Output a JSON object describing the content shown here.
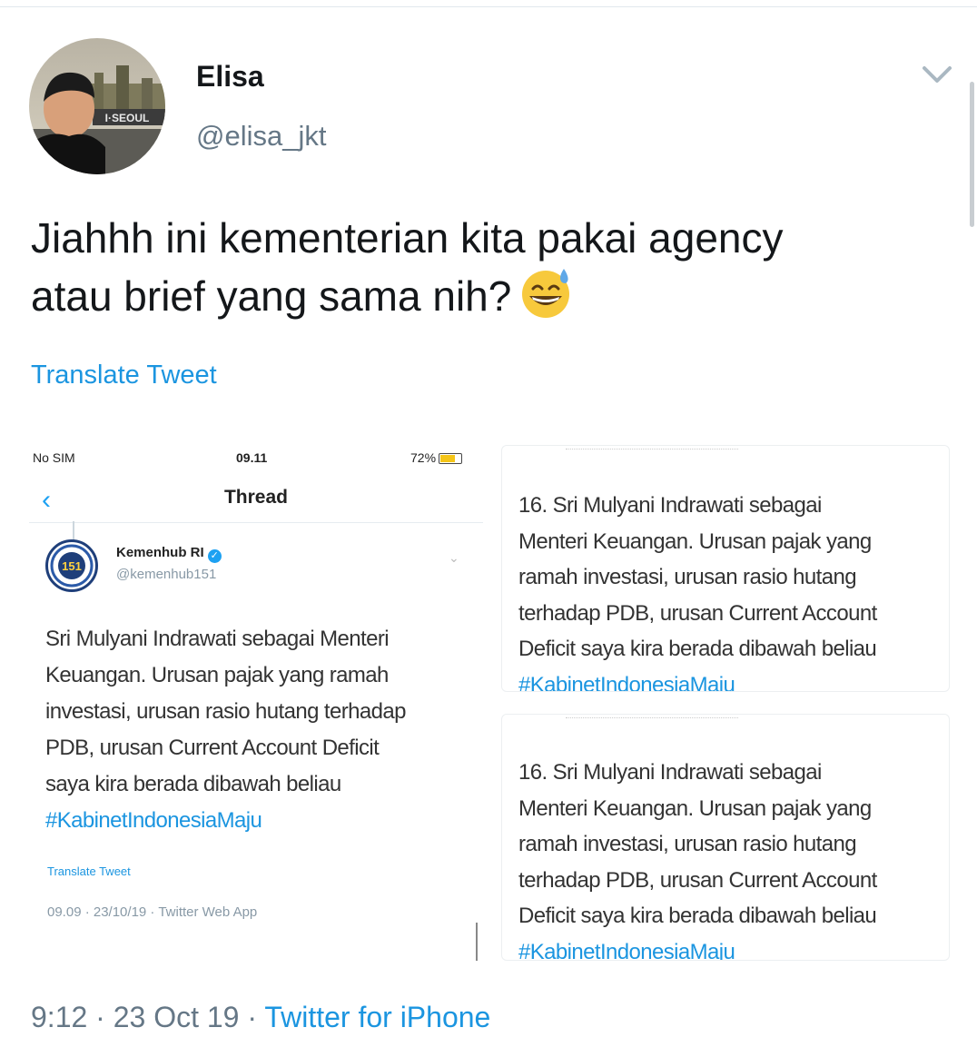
{
  "author": {
    "display_name": "Elisa",
    "handle": "@elisa_jkt",
    "avatar_icon": "profile-photo",
    "avatar_sign_text": "I·SEOUL"
  },
  "tweet": {
    "text_line1": "Jiahhh ini kementerian kita pakai agency",
    "text_line2": "atau brief yang sama nih?",
    "emoji": "grinning-face-with-sweat",
    "translate_label": "Translate Tweet",
    "time": "9:12",
    "date": "23 Oct 19",
    "source": "Twitter for iPhone",
    "separator": "·"
  },
  "media_1": {
    "status_carrier": "No SIM",
    "status_time": "09.11",
    "status_battery": "72%",
    "header_title": "Thread",
    "account_name": "Kemenhub RI",
    "account_handle": "@kemenhub151",
    "logo_text": "151",
    "line1": "Sri Mulyani Indrawati sebagai Menteri",
    "line2": "Keuangan. Urusan pajak  yang ramah",
    "line3": "investasi, urusan  rasio hutang terhadap",
    "line4": "PDB, urusan Current Account Deficit",
    "line5": "saya kira berada dibawah beliau",
    "hashtag": "#KabinetIndonesiaMaju",
    "translate_label": "Translate Tweet",
    "meta": "09.09 · 23/10/19 · Twitter Web App"
  },
  "media_2": {
    "line1": "16. Sri Mulyani Indrawati sebagai",
    "line2": "Menteri Keuangan. Urusan pajak  yang",
    "line3": "ramah investasi, urusan  rasio hutang",
    "line4": "terhadap PDB, urusan Current Account",
    "line5": "Deficit saya kira berada dibawah beliau",
    "hashtag": "#KabinetIndonesiaMaju"
  },
  "media_3": {
    "line1": "16. Sri Mulyani Indrawati sebagai",
    "line2": "Menteri Keuangan. Urusan pajak  yang",
    "line3": "ramah investasi, urusan  rasio hutang",
    "line4": "terhadap PDB, urusan Current Account",
    "line5": "Deficit saya kira berada dibawah beliau",
    "hashtag": "#KabinetIndonesiaMaju"
  },
  "colors": {
    "link": "#1b95e0",
    "secondary_text": "#657786",
    "primary_text": "#14171a"
  }
}
